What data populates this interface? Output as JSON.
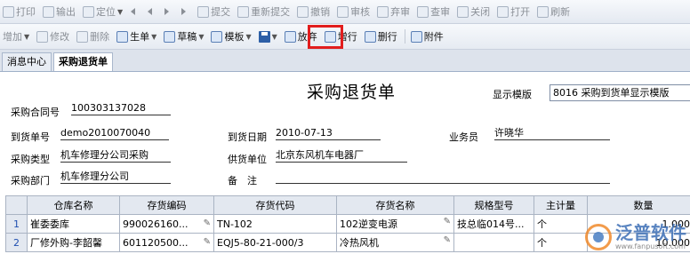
{
  "toolbar_top": {
    "items": [
      "打印",
      "输出",
      "定位",
      "",
      "",
      "",
      "",
      "提交",
      "重新提交",
      "撤销",
      "审核",
      "弃审",
      "查审",
      "关闭",
      "打开",
      "刷新"
    ]
  },
  "toolbar_main": {
    "add": "增加",
    "modify": "修改",
    "delete": "删除",
    "generate": "生单",
    "draft": "草稿",
    "template": "模板",
    "abandon": "放弃",
    "add_row": "增行",
    "delete_row": "删行",
    "attachment": "附件"
  },
  "tabs": [
    "消息中心",
    "采购退货单"
  ],
  "form": {
    "title": "采购退货单",
    "template_label": "显示模版",
    "template_value": "8016 采购到货单显示模版",
    "fields": {
      "contract_label": "采购合同号",
      "contract_value": "100303137028",
      "arrival_no_label": "到货单号",
      "arrival_no_value": "demo2010070040",
      "arrival_date_label": "到货日期",
      "arrival_date_value": "2010-07-13",
      "salesman_label": "业务员",
      "salesman_value": "许晓华",
      "purchase_type_label": "采购类型",
      "purchase_type_value": "机车修理分公司采购",
      "supplier_label": "供货单位",
      "supplier_value": "北京东风机车电器厂",
      "dept_label": "采购部门",
      "dept_value": "机车修理分公司",
      "remark_label": "备　注",
      "remark_value": ""
    }
  },
  "table": {
    "headers": [
      "",
      "仓库名称",
      "存货编码",
      "存货代码",
      "存货名称",
      "规格型号",
      "主计量",
      "数量"
    ],
    "rows": [
      [
        "1",
        "崔委委库",
        "990026160...",
        "TN-102",
        "102逆变电源",
        "技总临014号...",
        "个",
        "1.0000"
      ],
      [
        "2",
        "厂修外购-李韶馨",
        "601120500...",
        "EQJ5-80-21-000/3",
        "冷热风机",
        "",
        "个",
        "10.0000"
      ]
    ]
  },
  "watermark": {
    "text": "泛普软件",
    "url": "www.fanpusoft.com"
  }
}
